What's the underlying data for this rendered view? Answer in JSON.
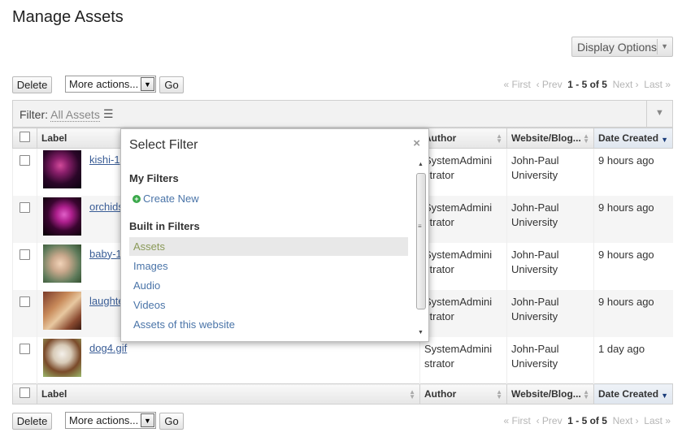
{
  "page": {
    "title": "Manage Assets"
  },
  "toolbar": {
    "display_options": "Display Options",
    "delete_label": "Delete",
    "actions_select": "More actions...",
    "go_label": "Go"
  },
  "pager": {
    "first": "« First",
    "prev": "‹ Prev",
    "range": "1 - 5 of 5",
    "next": "Next ›",
    "last": "Last »"
  },
  "filter": {
    "label": "Filter:",
    "value": "All Assets",
    "menu_icon": "list-icon",
    "toggle_icon": "triangle-down-icon"
  },
  "columns": {
    "label": "Label",
    "author": "Author",
    "site": "Website/Blog...",
    "date": "Date Created"
  },
  "rows": [
    {
      "label": "kishi-1",
      "author_1": "SystemAdmini",
      "author_2": "strator",
      "site_1": "John-Paul",
      "site_2": "University",
      "date": "9 hours ago"
    },
    {
      "label": "orchids",
      "author_1": "SystemAdmini",
      "author_2": "strator",
      "site_1": "John-Paul",
      "site_2": "University",
      "date": "9 hours ago"
    },
    {
      "label": "baby-1",
      "author_1": "SystemAdmini",
      "author_2": "strator",
      "site_1": "John-Paul",
      "site_2": "University",
      "date": "9 hours ago"
    },
    {
      "label": "laughte",
      "author_1": "SystemAdmini",
      "author_2": "strator",
      "site_1": "John-Paul",
      "site_2": "University",
      "date": "9 hours ago"
    },
    {
      "label": "dog4.gif",
      "author_1": "SystemAdmini",
      "author_2": "strator",
      "site_1": "John-Paul",
      "site_2": "University",
      "date": "1 day ago"
    }
  ],
  "popup": {
    "title": "Select Filter",
    "close": "×",
    "my_filters": "My Filters",
    "create_new": "Create New",
    "builtin": "Built in Filters",
    "items": [
      "Assets",
      "Images",
      "Audio",
      "Videos",
      "Assets of this website"
    ]
  },
  "colors": {
    "link": "#3a5d96",
    "selected_item": "#8a9a58"
  }
}
